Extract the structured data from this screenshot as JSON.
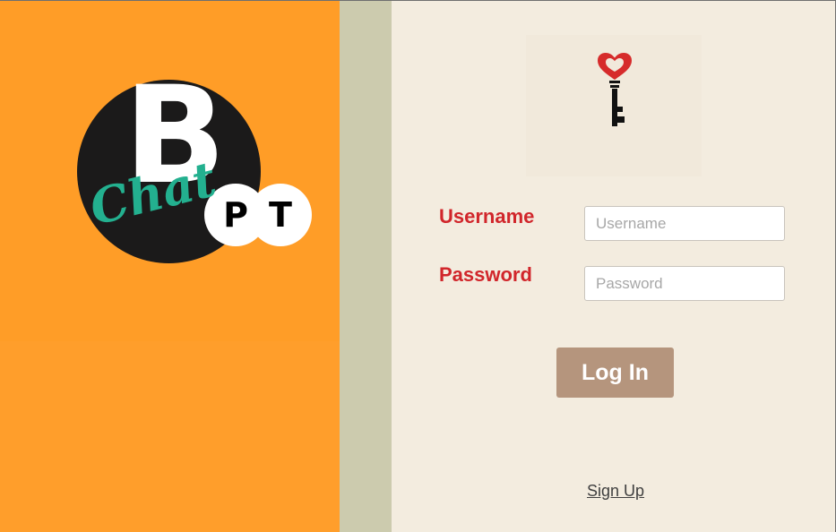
{
  "logo": {
    "main_letter": "B",
    "script_text": "Chat",
    "bubble_1": "P",
    "bubble_2": "T",
    "colors": {
      "circle": "#1b1a1a",
      "script": "#23b08f",
      "letters": "#ffffff"
    }
  },
  "key_icon": {
    "name": "heart-key-icon",
    "colors": {
      "heart": "#d62b2b",
      "key": "#111111"
    }
  },
  "form": {
    "username_label": "Username",
    "username_placeholder": "Username",
    "username_value": "",
    "password_label": "Password",
    "password_placeholder": "Password",
    "password_value": ""
  },
  "actions": {
    "login_label": "Log In",
    "signup_label": "Sign Up"
  },
  "colors": {
    "left_panel": "#ff9d27",
    "divider": "#cccbae",
    "right_panel": "#f3ecdf",
    "label_text": "#d1262b",
    "button": "#b5957d"
  }
}
